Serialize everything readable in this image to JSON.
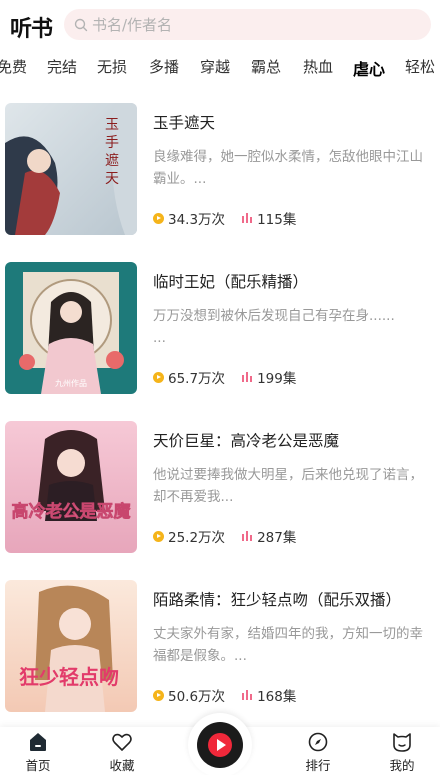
{
  "header": {
    "logo": "听书",
    "search_placeholder": "书名/作者名"
  },
  "tabs": [
    {
      "label": "免费"
    },
    {
      "label": "完结"
    },
    {
      "label": "无损"
    },
    {
      "label": "多播"
    },
    {
      "label": "穿越"
    },
    {
      "label": "霸总"
    },
    {
      "label": "热血"
    },
    {
      "label": "虐心",
      "active": true
    },
    {
      "label": "轻松"
    }
  ],
  "books": [
    {
      "title": "玉手遮天",
      "desc": "良缘难得，她一腔似水柔情，怎敌他眼中江山霸业。...",
      "plays": "34.3万次",
      "episodes": "115集",
      "cover_text": "玉手遮天"
    },
    {
      "title": "临时王妃（配乐精播）",
      "desc": "万万没想到被休后发现自己有孕在身......\n...",
      "plays": "65.7万次",
      "episodes": "199集",
      "cover_text": "九州作品"
    },
    {
      "title": "天价巨星：高冷老公是恶魔",
      "desc": "他说过要捧我做大明星，后来他兑现了诺言，却不再爱我...",
      "plays": "25.2万次",
      "episodes": "287集",
      "cover_text": "高冷老公是恶魔"
    },
    {
      "title": "陌路柔情：狂少轻点吻（配乐双播）",
      "desc": "丈夫家外有家，结婚四年的我，方知一切的幸福都是假象。...",
      "plays": "50.6万次",
      "episodes": "168集",
      "cover_text": "狂少轻点吻"
    }
  ],
  "nav": {
    "home": "首页",
    "favorites": "收藏",
    "ranking": "排行",
    "mine": "我的"
  },
  "icons": {
    "search": "search-icon",
    "play": "play-icon",
    "episodes": "equalizer-icon",
    "home": "home-icon",
    "favorites": "heart-icon",
    "ranking": "compass-icon",
    "mine": "cat-face-icon",
    "player": "record-play-icon"
  },
  "colors": {
    "accent_yellow": "#ffd400",
    "play_orange": "#f5b41a",
    "episode_pink": "#f06a8a",
    "player_red": "#f0283a",
    "search_bg": "#fbeeee"
  }
}
